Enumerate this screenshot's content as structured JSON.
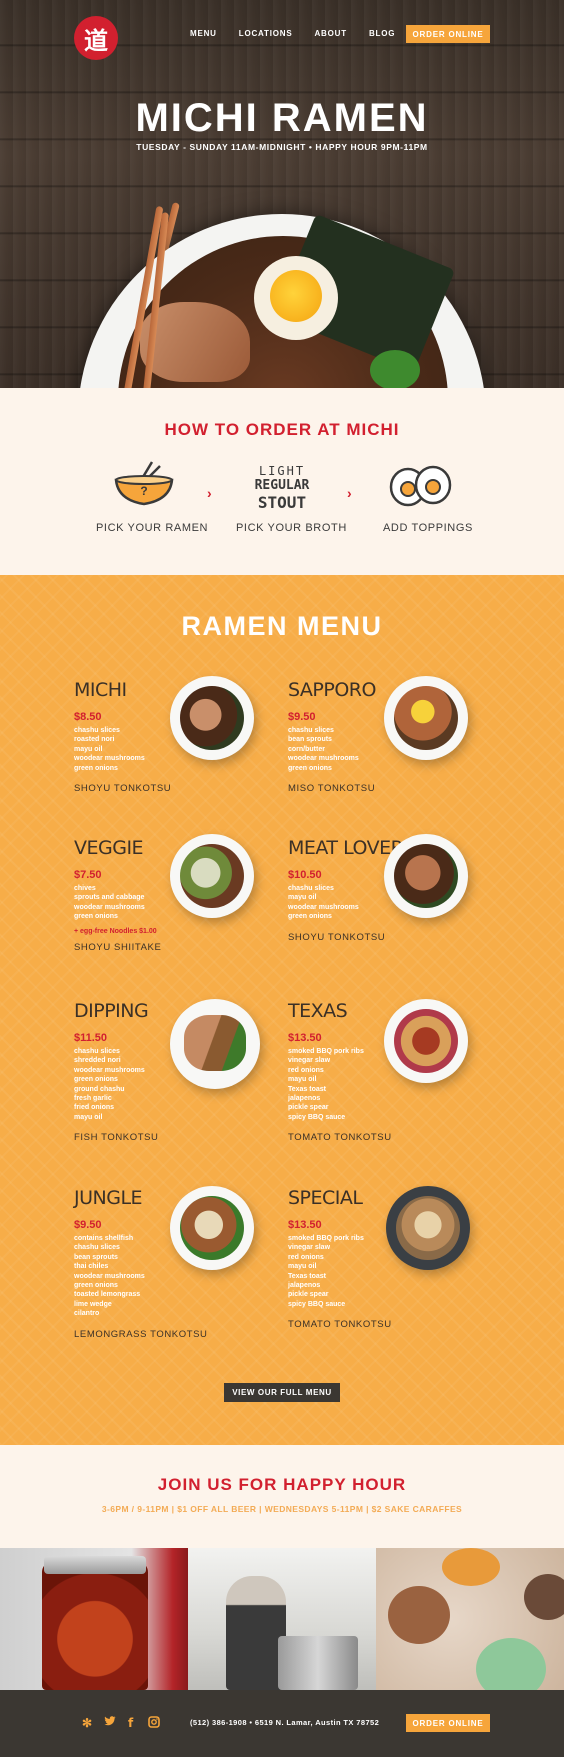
{
  "brand": {
    "logo_glyph": "道",
    "red": "#d2202f",
    "orange": "#f6a53b"
  },
  "nav": {
    "items": [
      "MENU",
      "LOCATIONS",
      "ABOUT",
      "BLOG"
    ],
    "order_label": "ORDER ONLINE"
  },
  "hero": {
    "title": "MICHI RAMEN",
    "subtitle": "TUESDAY - SUNDAY 11AM-MIDNIGHT • HAPPY HOUR 9PM-11PM"
  },
  "how_to_order": {
    "title": "HOW TO ORDER AT MICHI",
    "steps": [
      "PICK YOUR RAMEN",
      "PICK YOUR BROTH",
      "ADD TOPPINGS"
    ],
    "broth_options": [
      "LIGHT",
      "REGULAR",
      "STOUT"
    ],
    "bowl_mark": "?"
  },
  "menu": {
    "title": "RAMEN MENU",
    "items": [
      {
        "name": "MICHI",
        "price": "$8.50",
        "ingredients": [
          "chashu slices",
          "roasted nori",
          "mayu oil",
          "woodear mushrooms",
          "green onions"
        ],
        "broth": "SHOYU TONKOTSU"
      },
      {
        "name": "SAPPORO",
        "price": "$9.50",
        "ingredients": [
          "chashu slices",
          "bean sprouts",
          "corn/butter",
          "woodear mushrooms",
          "green onions"
        ],
        "broth": "MISO TONKOTSU"
      },
      {
        "name": "VEGGIE",
        "price": "$7.50",
        "ingredients": [
          "chives",
          "sprouts and cabbage",
          "woodear mushrooms",
          "green onions"
        ],
        "note": "+ egg-free Noodles $1.00",
        "broth": "SHOYU SHIITAKE"
      },
      {
        "name": "MEAT LOVERS",
        "price": "$10.50",
        "ingredients": [
          "chashu slices",
          "mayu oil",
          "woodear mushrooms",
          "green onions"
        ],
        "broth": "SHOYU TONKOTSU"
      },
      {
        "name": "DIPPING",
        "price": "$11.50",
        "ingredients": [
          "chashu slices",
          "shredded nori",
          "woodear mushrooms",
          "green onions",
          "ground chashu",
          "fresh garlic",
          "fried onions",
          "mayu oil"
        ],
        "broth": "FISH TONKOTSU"
      },
      {
        "name": "TEXAS",
        "price": "$13.50",
        "ingredients": [
          "smoked BBQ pork ribs",
          "vinegar slaw",
          "red onions",
          "mayu oil",
          "Texas toast",
          "jalapenos",
          "pickle spear",
          "spicy BBQ sauce"
        ],
        "broth": "TOMATO TONKOTSU"
      },
      {
        "name": "JUNGLE",
        "price": "$9.50",
        "ingredients": [
          "contains shellfish",
          "chashu slices",
          "bean sprouts",
          "thai chiles",
          "woodear mushrooms",
          "green onions",
          "toasted lemongrass",
          "lime wedge",
          "cilantro"
        ],
        "broth": "LEMONGRASS TONKOTSU"
      },
      {
        "name": "SPECIAL",
        "price": "$13.50",
        "ingredients": [
          "smoked BBQ pork ribs",
          "vinegar slaw",
          "red onions",
          "mayu oil",
          "Texas toast",
          "jalapenos",
          "pickle spear",
          "spicy BBQ sauce"
        ],
        "broth": "TOMATO TONKOTSU"
      }
    ],
    "full_menu_label": "VIEW OUR FULL MENU"
  },
  "happy_hour": {
    "title": "JOIN US FOR HAPPY HOUR",
    "subtitle": "3-6PM / 9-11PM | $1 OFF ALL BEER | WEDNESDAYS 5-11PM | $2 SAKE CARAFFES"
  },
  "footer": {
    "social_icons": [
      "yelp-icon",
      "twitter-icon",
      "facebook-icon",
      "instagram-icon"
    ],
    "contact": "(512) 386-1908 • 6519 N. Lamar, Austin TX 78752",
    "order_label": "ORDER ONLINE"
  }
}
